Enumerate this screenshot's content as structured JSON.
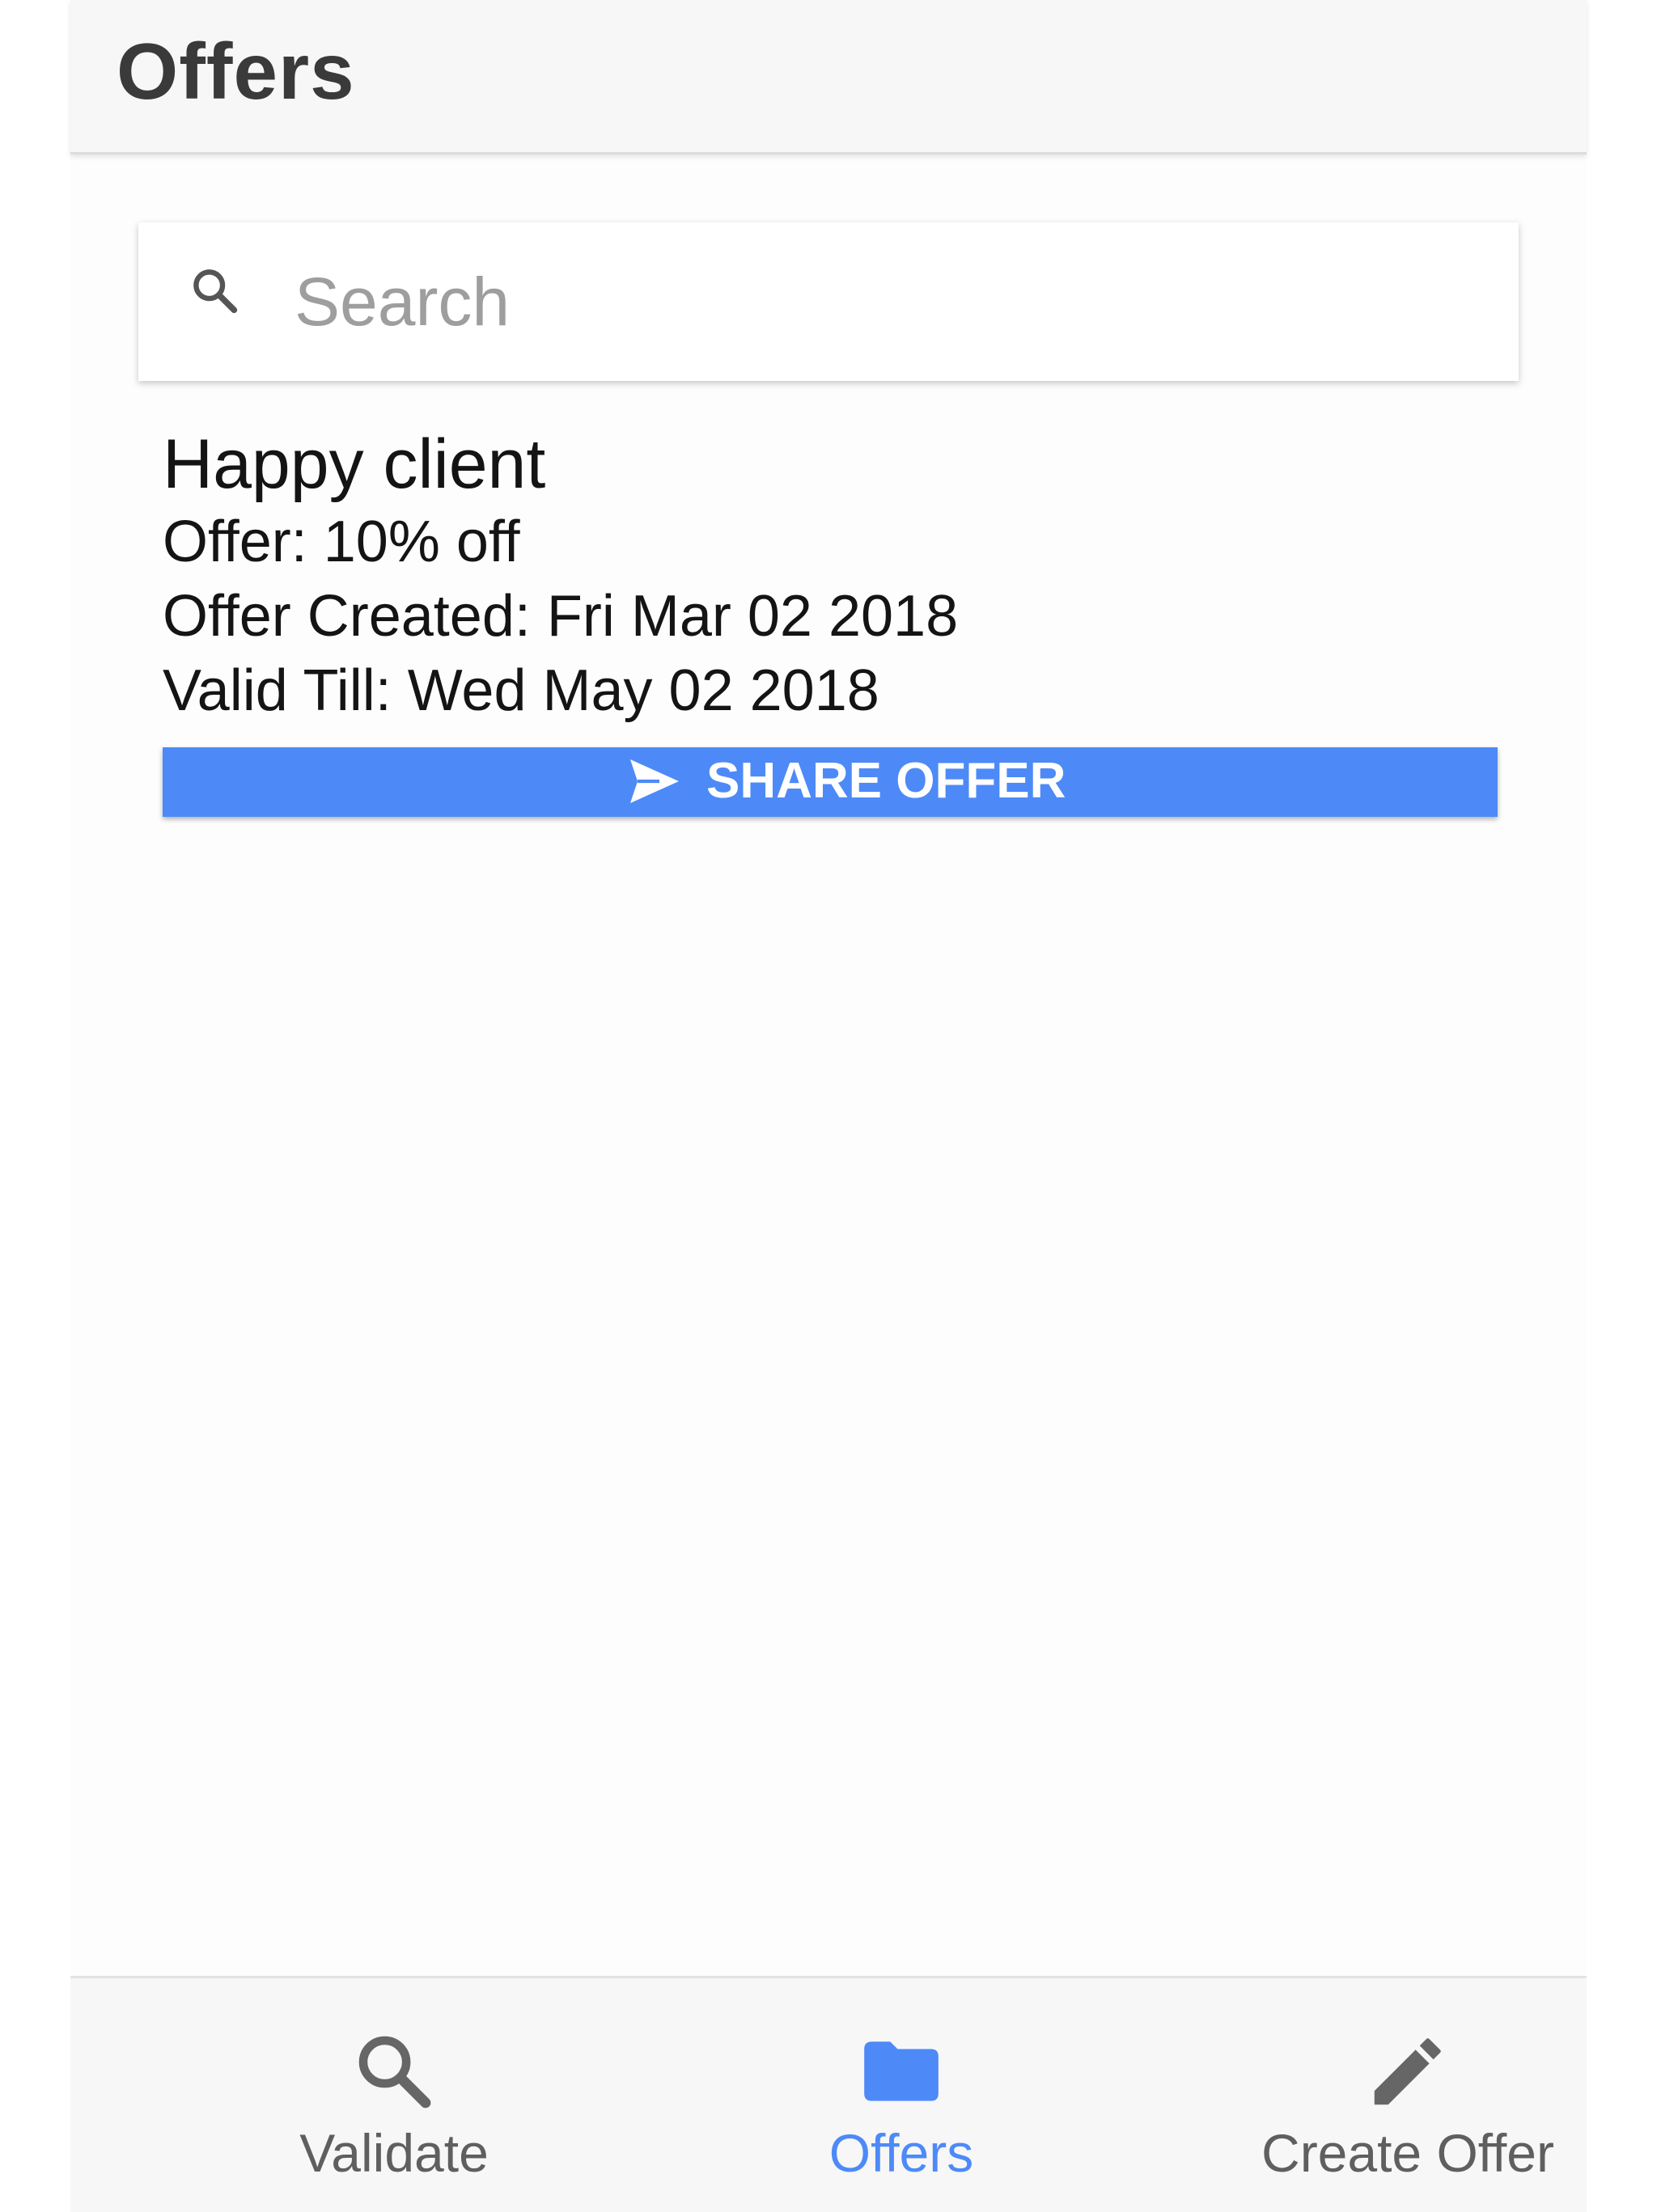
{
  "header": {
    "title": "Offers"
  },
  "search": {
    "placeholder": "Search",
    "value": "",
    "icon": "search-icon"
  },
  "offers": [
    {
      "name": "Happy client",
      "offer": "Offer: 10% off",
      "created": "Offer Created: Fri Mar 02 2018",
      "valid_till": "Valid Till: Wed May 02 2018",
      "share_label": "SHARE OFFER",
      "share_icon": "send-icon"
    }
  ],
  "bottom_nav": {
    "items": [
      {
        "label": "Validate",
        "icon": "search-icon",
        "active": false
      },
      {
        "label": "Offers",
        "icon": "folder-icon",
        "active": true
      },
      {
        "label": "Create Offer",
        "icon": "pencil-icon",
        "active": false
      }
    ]
  },
  "colors": {
    "accent": "#4d8af8",
    "header_bg": "#f7f7f7",
    "text_dark": "#141414",
    "nav_inactive": "#5f5f5f"
  }
}
